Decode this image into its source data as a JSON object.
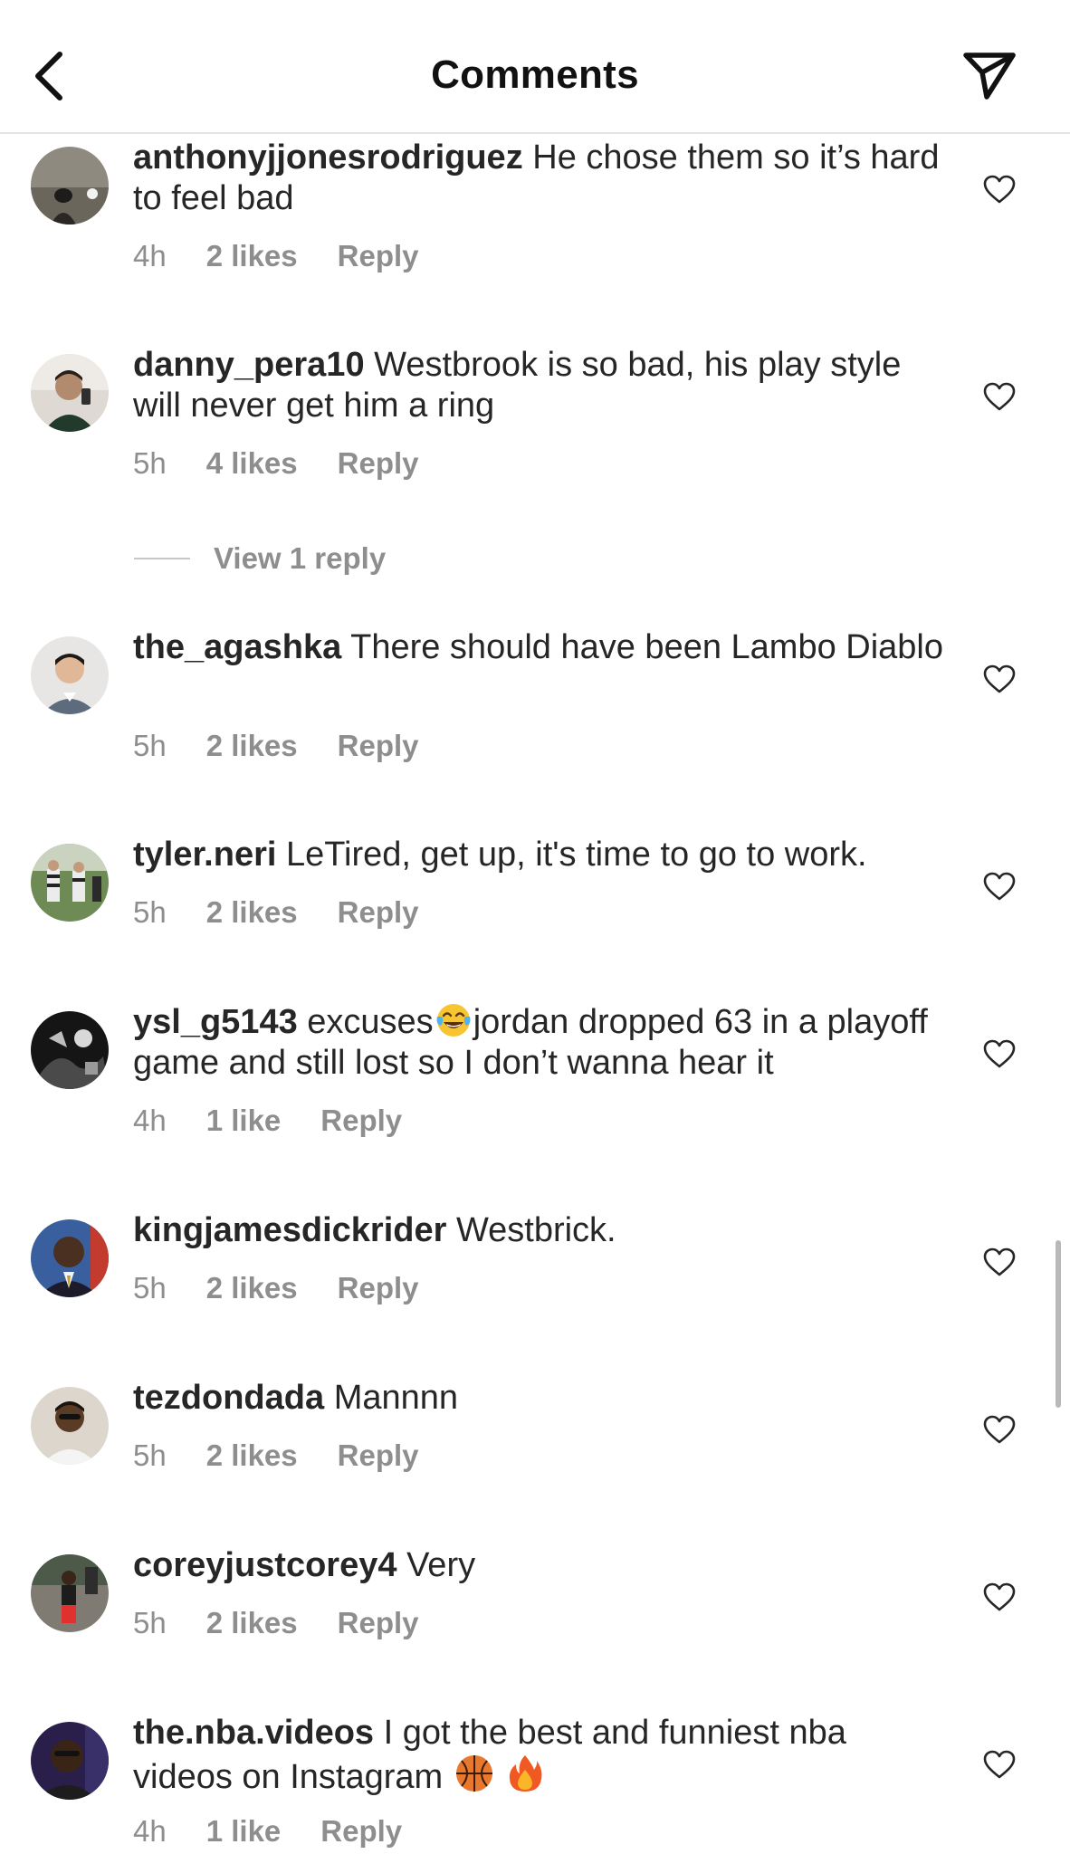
{
  "header": {
    "title": "Comments",
    "back_icon": "chevron-left-icon",
    "share_icon": "paper-plane-icon"
  },
  "comments": [
    {
      "username": "anthonyjjonesrodriguez",
      "text": "He chose them so it’s hard to feel bad",
      "time": "4h",
      "likes": "2 likes",
      "reply": "Reply"
    },
    {
      "username": "danny_pera10",
      "text": "Westbrook is so bad, his play style will never get him a ring",
      "time": "5h",
      "likes": "4 likes",
      "reply": "Reply"
    },
    {
      "username": "the_agashka",
      "text": "There should have been Lambo Diablo",
      "time": "5h",
      "likes": "2 likes",
      "reply": "Reply"
    },
    {
      "username": "tyler.neri",
      "text": "LeTired, get up, it's time to go to work.",
      "time": "5h",
      "likes": "2 likes",
      "reply": "Reply"
    },
    {
      "username": "ysl_g5143",
      "text_before_emoji": "excuses",
      "emoji": "tears-of-joy-emoji",
      "text_after_emoji": "jordan dropped 63 in a playoff game and still lost so I don’t wanna hear it",
      "time": "4h",
      "likes": "1 like",
      "reply": "Reply"
    },
    {
      "username": "kingjamesdickrider",
      "text": "Westbrick.",
      "time": "5h",
      "likes": "2 likes",
      "reply": "Reply"
    },
    {
      "username": "tezdondada",
      "text": "Mannnn",
      "time": "5h",
      "likes": "2 likes",
      "reply": "Reply"
    },
    {
      "username": "coreyjustcorey4",
      "text": "Very",
      "time": "5h",
      "likes": "2 likes",
      "reply": "Reply"
    },
    {
      "username": "the.nba.videos",
      "text": "I got the best and funniest nba videos on Instagram",
      "emojis": [
        "basketball-emoji",
        "fire-emoji"
      ],
      "time": "4h",
      "likes": "1 like",
      "reply": "Reply"
    }
  ],
  "view_replies": "View 1 reply",
  "colors": {
    "text": "#262626",
    "meta": "#8e8e8e",
    "divider": "#e4e4e4"
  }
}
